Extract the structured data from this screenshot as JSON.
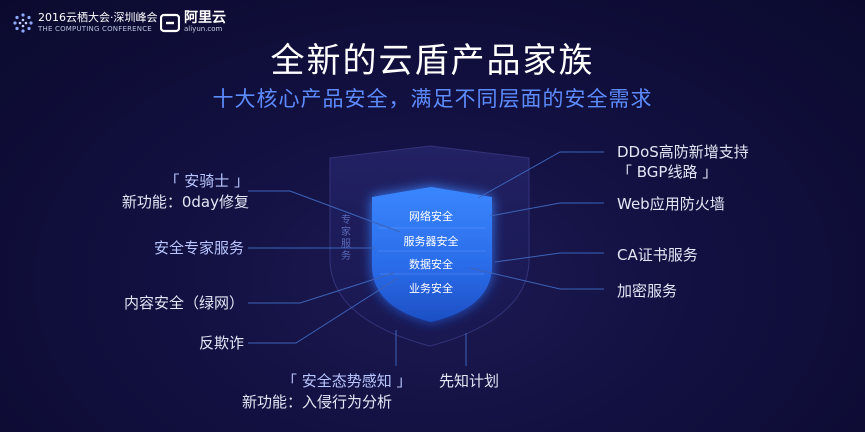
{
  "header": {
    "conference_line1": "2016云栖大会·深圳峰会",
    "conference_line2": "THE COMPUTING CONFERENCE",
    "brand_name": "阿里云",
    "brand_domain": "aliyun.com"
  },
  "title": "全新的云盾产品家族",
  "subtitle": "十大核心产品安全，满足不同层面的安全需求",
  "shield": {
    "outer_label": "专家服务",
    "items": [
      "网络安全",
      "服务器安全",
      "数据安全",
      "业务安全"
    ]
  },
  "left_products": {
    "anqishi_name": "「 安骑士 」",
    "anqishi_feature": "新功能：0day修复",
    "expert_service": "安全专家服务",
    "content_security": "内容安全（绿网）",
    "anti_fraud": "反欺诈"
  },
  "bottom_products": {
    "situation_name": "「 安全态势感知 」",
    "situation_feature": "新功能：入侵行为分析",
    "xianzhi": "先知计划"
  },
  "right_products": {
    "ddos_line1": "DDoS高防新增支持",
    "ddos_line2": "「 BGP线路 」",
    "waf": "Web应用防火墙",
    "ca": "CA证书服务",
    "encryption": "加密服务"
  },
  "colors": {
    "background": "#121040",
    "title": "#ffffff",
    "subtitle": "#5d8cff",
    "shield_inner": "#2b73f0",
    "connector": "#3e63b8"
  },
  "icons": [
    "conference-logo-icon",
    "aliyun-logo-icon"
  ]
}
